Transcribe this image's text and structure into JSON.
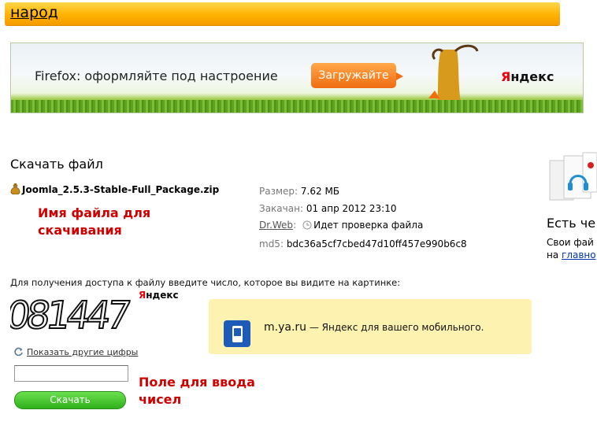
{
  "header": {
    "logo": "народ"
  },
  "banner": {
    "headline": "Firefox: оформляйте под настроение",
    "cta": "Загружайте",
    "brand_first": "Я",
    "brand_rest": "ндекс"
  },
  "download": {
    "title": "Скачать файл",
    "filename": "Joomla_2.5.3-Stable-Full_Package.zip",
    "size_label": "Размер:",
    "size_value": "7.62 МБ",
    "uploaded_label": "Закачан:",
    "uploaded_value": "01 апр 2012 23:10",
    "drweb_label": "Dr.Web",
    "drweb_status": "Идет проверка файла",
    "md5_label": "md5:",
    "md5_value": "bdc36a5cf7cbed47d10ff457e990b6c8"
  },
  "annotations": {
    "filename_note_line1": "Имя файла для",
    "filename_note_line2": "скачивания",
    "input_note_line1": "Поле для ввода",
    "input_note_line2": "чисел"
  },
  "sidebar": {
    "title": "Есть че",
    "line1": "Свои фай",
    "line2_prefix": "на ",
    "line2_link": "главно"
  },
  "captcha": {
    "instruction": "Для получения доступа к файлу введите число, которое вы видите на картинке:",
    "digits": "081447",
    "brand_first": "Я",
    "brand_rest": "ндекс",
    "refresh_label": "Показать другие цифры",
    "input_value": "",
    "submit_label": "Скачать"
  },
  "mobile_promo": {
    "site": "m.ya.ru",
    "text": " — Яндекс для вашего мобильного."
  },
  "colors": {
    "topbar": "#ffb300",
    "annotation": "#d00000",
    "cta": "#f06d10",
    "submit": "#2fb01a",
    "promo_bg": "#fdf2b0",
    "phone_icon": "#1e5bb8"
  }
}
